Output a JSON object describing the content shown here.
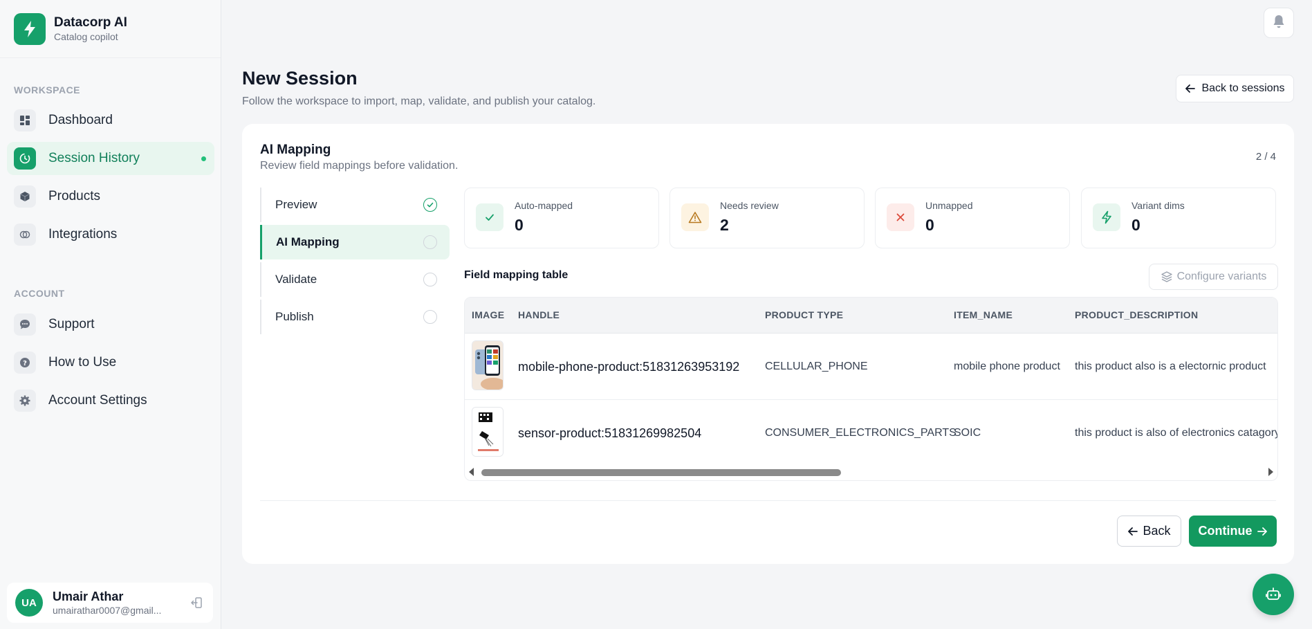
{
  "brand": {
    "name": "Datacorp AI",
    "subtitle": "Catalog copilot"
  },
  "sidebar": {
    "workspace_label": "WORKSPACE",
    "workspace_items": [
      {
        "label": "Dashboard",
        "icon": "dashboard-icon"
      },
      {
        "label": "Session History",
        "icon": "history-icon",
        "active": true
      },
      {
        "label": "Products",
        "icon": "cube-icon"
      },
      {
        "label": "Integrations",
        "icon": "link-icon"
      }
    ],
    "account_label": "ACCOUNT",
    "account_items": [
      {
        "label": "Support",
        "icon": "chat-icon"
      },
      {
        "label": "How to Use",
        "icon": "help-icon"
      },
      {
        "label": "Account Settings",
        "icon": "gear-icon"
      }
    ]
  },
  "user": {
    "initials": "UA",
    "name": "Umair Athar",
    "email": "umairathar0007@gmail..."
  },
  "header": {
    "title": "New Session",
    "subtitle": "Follow the workspace to import, map, validate, and publish your catalog.",
    "back_to_sessions": "Back to sessions"
  },
  "card": {
    "title": "AI Mapping",
    "subtitle": "Review field mappings before validation.",
    "step_count": "2 / 4"
  },
  "steps": [
    {
      "label": "Preview",
      "status": "done"
    },
    {
      "label": "AI Mapping",
      "status": "active"
    },
    {
      "label": "Validate",
      "status": "pending"
    },
    {
      "label": "Publish",
      "status": "pending"
    }
  ],
  "stats": [
    {
      "label": "Auto-mapped",
      "value": "0",
      "icon": "check-icon",
      "color": "#16a06a",
      "bg": "#e8f6ef"
    },
    {
      "label": "Needs review",
      "value": "2",
      "icon": "warning-icon",
      "color": "#b7791f",
      "bg": "#fdf3e1"
    },
    {
      "label": "Unmapped",
      "value": "0",
      "icon": "x-icon",
      "color": "#dc4a3a",
      "bg": "#fdecea"
    },
    {
      "label": "Variant dims",
      "value": "0",
      "icon": "bolt-icon",
      "color": "#16a06a",
      "bg": "#e8f6ef"
    }
  ],
  "table": {
    "title": "Field mapping table",
    "configure_label": "Configure variants",
    "columns": [
      "IMAGE",
      "HANDLE",
      "PRODUCT TYPE",
      "ITEM_NAME",
      "PRODUCT_DESCRIPTION"
    ],
    "rows": [
      {
        "handle": "mobile-phone-product:51831263953192",
        "product_type": "CELLULAR_PHONE",
        "item_name": "mobile phone product",
        "description": "this product also is a electornic product"
      },
      {
        "handle": "sensor-product:51831269982504",
        "product_type": "CONSUMER_ELECTRONICS_PARTS",
        "item_name": "SOIC",
        "description": "this product is also of electronics catagory"
      }
    ]
  },
  "actions": {
    "back": "Back",
    "continue": "Continue"
  },
  "colors": {
    "accent": "#16a06a",
    "accent_light": "#e8f6ef"
  }
}
